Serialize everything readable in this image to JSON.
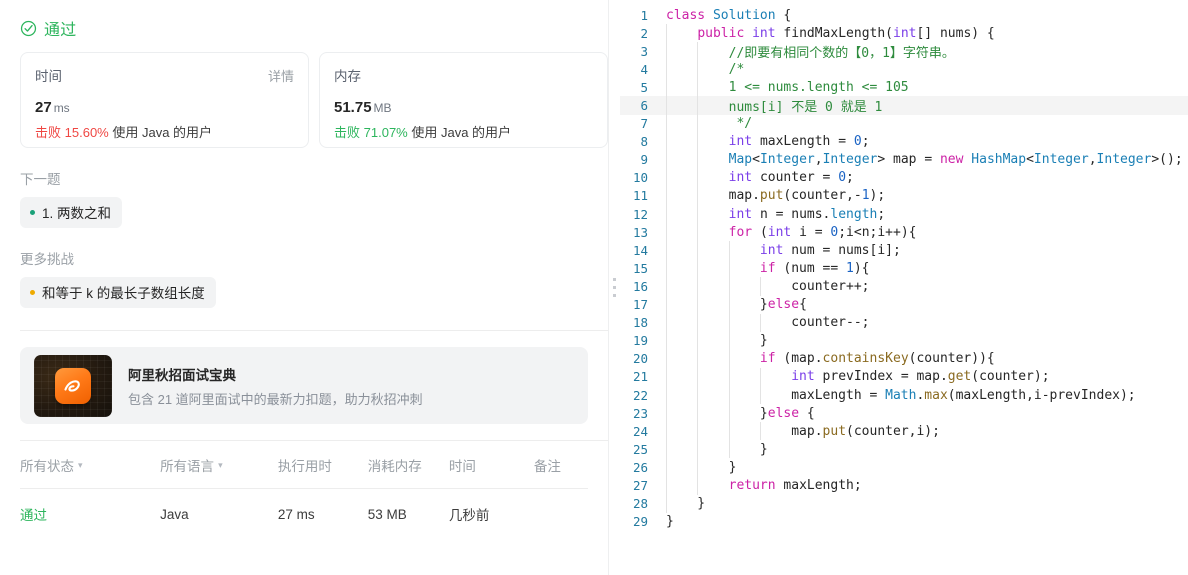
{
  "result": {
    "status_icon": "check-circle-icon",
    "status_text": "通过",
    "status_color": "#2db55d"
  },
  "metrics": [
    {
      "label": "时间",
      "action_label": "详情",
      "value": "27",
      "unit": "ms",
      "beat_prefix": "击败",
      "beat_pct": "15.60%",
      "beat_suffix": "使用 Java 的用户",
      "pct_color": "#ef4743"
    },
    {
      "label": "内存",
      "action_label": "",
      "value": "51.75",
      "unit": "MB",
      "beat_prefix": "击败",
      "beat_pct": "71.07%",
      "beat_suffix": "使用 Java 的用户",
      "pct_color": "#2db55d"
    }
  ],
  "next_problem": {
    "section_label": "下一题",
    "tag": "1. 两数之和",
    "difficulty": "easy",
    "dot_color": "#1aa179"
  },
  "more_challenges": {
    "section_label": "更多挑战",
    "tag": "和等于 k 的最长子数组长度",
    "difficulty": "medium",
    "dot_color": "#eeaa00"
  },
  "promo": {
    "icon": "alibaba-logo-icon",
    "title": "阿里秋招面试宝典",
    "subtitle": "包含 21 道阿里面试中的最新力扣题，助力秋招冲刺"
  },
  "submissions_table": {
    "headers": [
      {
        "label": "所有状态",
        "has_caret": true
      },
      {
        "label": "所有语言",
        "has_caret": true
      },
      {
        "label": "执行用时",
        "has_caret": false
      },
      {
        "label": "消耗内存",
        "has_caret": false
      },
      {
        "label": "时间",
        "has_caret": false
      },
      {
        "label": "备注",
        "has_caret": false
      }
    ],
    "rows": [
      {
        "status": "通过",
        "language": "Java",
        "runtime": "27 ms",
        "memory": "53 MB",
        "time": "几秒前",
        "note": ""
      }
    ]
  },
  "splitter": {
    "name": "panel-resize-handle"
  },
  "editor": {
    "language": "java",
    "active_line": 6,
    "total_lines": 29,
    "lines": [
      {
        "n": "1",
        "indent": 0,
        "tokens": [
          {
            "t": "class ",
            "c": "kw"
          },
          {
            "t": "Solution",
            "c": "typ"
          },
          {
            "t": " {",
            "c": "pln"
          }
        ]
      },
      {
        "n": "2",
        "indent": 1,
        "tokens": [
          {
            "t": "    ",
            "c": "pln"
          },
          {
            "t": "public ",
            "c": "kw"
          },
          {
            "t": "int ",
            "c": "kw2"
          },
          {
            "t": "findMaxLength",
            "c": "pln"
          },
          {
            "t": "(",
            "c": "pln"
          },
          {
            "t": "int",
            "c": "kw2"
          },
          {
            "t": "[] nums) {",
            "c": "pln"
          }
        ]
      },
      {
        "n": "3",
        "indent": 2,
        "tokens": [
          {
            "t": "        //即要有相同个数的【0，1】字符串。",
            "c": "cmt"
          }
        ]
      },
      {
        "n": "4",
        "indent": 2,
        "tokens": [
          {
            "t": "        /*",
            "c": "cmt"
          }
        ]
      },
      {
        "n": "5",
        "indent": 2,
        "tokens": [
          {
            "t": "        1 <= nums.length <= 105",
            "c": "cmt"
          }
        ]
      },
      {
        "n": "6",
        "indent": 2,
        "tokens": [
          {
            "t": "        nums[i] 不是 0 就是 1",
            "c": "cmt"
          }
        ]
      },
      {
        "n": "7",
        "indent": 2,
        "tokens": [
          {
            "t": "         */",
            "c": "cmt"
          }
        ]
      },
      {
        "n": "8",
        "indent": 2,
        "tokens": [
          {
            "t": "        ",
            "c": "pln"
          },
          {
            "t": "int ",
            "c": "kw2"
          },
          {
            "t": "maxLength = ",
            "c": "pln"
          },
          {
            "t": "0",
            "c": "num"
          },
          {
            "t": ";",
            "c": "pln"
          }
        ]
      },
      {
        "n": "9",
        "indent": 2,
        "tokens": [
          {
            "t": "        ",
            "c": "pln"
          },
          {
            "t": "Map",
            "c": "typ"
          },
          {
            "t": "<",
            "c": "pln"
          },
          {
            "t": "Integer",
            "c": "typ"
          },
          {
            "t": ",",
            "c": "pln"
          },
          {
            "t": "Integer",
            "c": "typ"
          },
          {
            "t": "> map = ",
            "c": "pln"
          },
          {
            "t": "new ",
            "c": "kw"
          },
          {
            "t": "HashMap",
            "c": "typ"
          },
          {
            "t": "<",
            "c": "pln"
          },
          {
            "t": "Integer",
            "c": "typ"
          },
          {
            "t": ",",
            "c": "pln"
          },
          {
            "t": "Integer",
            "c": "typ"
          },
          {
            "t": ">();",
            "c": "pln"
          }
        ]
      },
      {
        "n": "10",
        "indent": 2,
        "tokens": [
          {
            "t": "        ",
            "c": "pln"
          },
          {
            "t": "int ",
            "c": "kw2"
          },
          {
            "t": "counter = ",
            "c": "pln"
          },
          {
            "t": "0",
            "c": "num"
          },
          {
            "t": ";",
            "c": "pln"
          }
        ]
      },
      {
        "n": "11",
        "indent": 2,
        "tokens": [
          {
            "t": "        map.",
            "c": "pln"
          },
          {
            "t": "put",
            "c": "fn"
          },
          {
            "t": "(counter,-",
            "c": "pln"
          },
          {
            "t": "1",
            "c": "num"
          },
          {
            "t": ");",
            "c": "pln"
          }
        ]
      },
      {
        "n": "12",
        "indent": 2,
        "tokens": [
          {
            "t": "        ",
            "c": "pln"
          },
          {
            "t": "int ",
            "c": "kw2"
          },
          {
            "t": "n = nums.",
            "c": "pln"
          },
          {
            "t": "length",
            "c": "typ"
          },
          {
            "t": ";",
            "c": "pln"
          }
        ]
      },
      {
        "n": "13",
        "indent": 2,
        "tokens": [
          {
            "t": "        ",
            "c": "pln"
          },
          {
            "t": "for ",
            "c": "kw"
          },
          {
            "t": "(",
            "c": "pln"
          },
          {
            "t": "int ",
            "c": "kw2"
          },
          {
            "t": "i = ",
            "c": "pln"
          },
          {
            "t": "0",
            "c": "num"
          },
          {
            "t": ";i<n;i++){",
            "c": "pln"
          }
        ]
      },
      {
        "n": "14",
        "indent": 3,
        "tokens": [
          {
            "t": "            ",
            "c": "pln"
          },
          {
            "t": "int ",
            "c": "kw2"
          },
          {
            "t": "num = nums[i];",
            "c": "pln"
          }
        ]
      },
      {
        "n": "15",
        "indent": 3,
        "tokens": [
          {
            "t": "            ",
            "c": "pln"
          },
          {
            "t": "if ",
            "c": "kw"
          },
          {
            "t": "(num == ",
            "c": "pln"
          },
          {
            "t": "1",
            "c": "num"
          },
          {
            "t": "){",
            "c": "pln"
          }
        ]
      },
      {
        "n": "16",
        "indent": 4,
        "tokens": [
          {
            "t": "                counter++;",
            "c": "pln"
          }
        ]
      },
      {
        "n": "17",
        "indent": 3,
        "tokens": [
          {
            "t": "            }",
            "c": "pln"
          },
          {
            "t": "else",
            "c": "kw"
          },
          {
            "t": "{",
            "c": "pln"
          }
        ]
      },
      {
        "n": "18",
        "indent": 4,
        "tokens": [
          {
            "t": "                counter--;",
            "c": "pln"
          }
        ]
      },
      {
        "n": "19",
        "indent": 3,
        "tokens": [
          {
            "t": "            }",
            "c": "pln"
          }
        ]
      },
      {
        "n": "20",
        "indent": 3,
        "tokens": [
          {
            "t": "            ",
            "c": "pln"
          },
          {
            "t": "if ",
            "c": "kw"
          },
          {
            "t": "(map.",
            "c": "pln"
          },
          {
            "t": "containsKey",
            "c": "fn"
          },
          {
            "t": "(counter)){",
            "c": "pln"
          }
        ]
      },
      {
        "n": "21",
        "indent": 4,
        "tokens": [
          {
            "t": "                ",
            "c": "pln"
          },
          {
            "t": "int ",
            "c": "kw2"
          },
          {
            "t": "prevIndex = map.",
            "c": "pln"
          },
          {
            "t": "get",
            "c": "fn"
          },
          {
            "t": "(counter);",
            "c": "pln"
          }
        ]
      },
      {
        "n": "22",
        "indent": 4,
        "tokens": [
          {
            "t": "                maxLength = ",
            "c": "pln"
          },
          {
            "t": "Math",
            "c": "typ"
          },
          {
            "t": ".",
            "c": "pln"
          },
          {
            "t": "max",
            "c": "fn"
          },
          {
            "t": "(maxLength,i-prevIndex);",
            "c": "pln"
          }
        ]
      },
      {
        "n": "23",
        "indent": 3,
        "tokens": [
          {
            "t": "            }",
            "c": "pln"
          },
          {
            "t": "else",
            "c": "kw"
          },
          {
            "t": " {",
            "c": "pln"
          }
        ]
      },
      {
        "n": "24",
        "indent": 4,
        "tokens": [
          {
            "t": "                map.",
            "c": "pln"
          },
          {
            "t": "put",
            "c": "fn"
          },
          {
            "t": "(counter,i);",
            "c": "pln"
          }
        ]
      },
      {
        "n": "25",
        "indent": 3,
        "tokens": [
          {
            "t": "            }",
            "c": "pln"
          }
        ]
      },
      {
        "n": "26",
        "indent": 2,
        "tokens": [
          {
            "t": "        }",
            "c": "pln"
          }
        ]
      },
      {
        "n": "27",
        "indent": 2,
        "tokens": [
          {
            "t": "        ",
            "c": "pln"
          },
          {
            "t": "return ",
            "c": "kw"
          },
          {
            "t": "maxLength;",
            "c": "pln"
          }
        ]
      },
      {
        "n": "28",
        "indent": 1,
        "tokens": [
          {
            "t": "    }",
            "c": "pln"
          }
        ]
      },
      {
        "n": "29",
        "indent": 0,
        "tokens": [
          {
            "t": "}",
            "c": "pln"
          }
        ]
      }
    ]
  }
}
